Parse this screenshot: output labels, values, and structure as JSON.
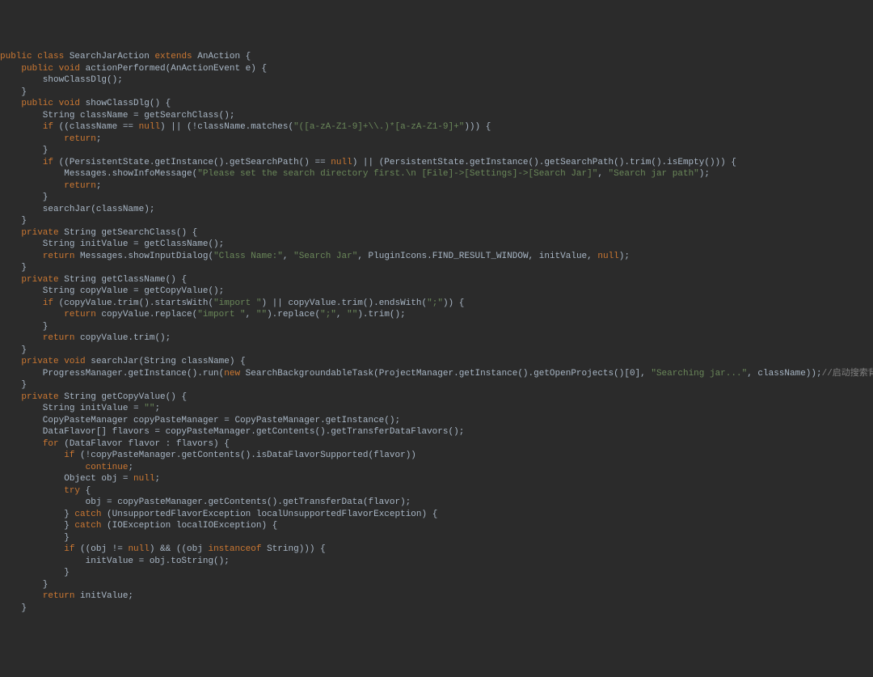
{
  "code": {
    "lines": [
      "public class SearchJarAction extends AnAction {",
      "    public void actionPerformed(AnActionEvent e) {",
      "        showClassDlg();",
      "    }",
      "",
      "    public void showClassDlg() {",
      "        String className = getSearchClass();",
      "        if ((className == null) || (!className.matches(\"([a-zA-Z1-9]+\\\\.)*[a-zA-Z1-9]+\"))) {",
      "            return;",
      "        }",
      "        if ((PersistentState.getInstance().getSearchPath() == null) || (PersistentState.getInstance().getSearchPath().trim().isEmpty())) {",
      "            Messages.showInfoMessage(\"Please set the search directory first.\\n [File]->[Settings]->[Search Jar]\", \"Search jar path\");",
      "            return;",
      "        }",
      "        searchJar(className);",
      "    }",
      "",
      "    private String getSearchClass() {",
      "        String initValue = getClassName();",
      "        return Messages.showInputDialog(\"Class Name:\", \"Search Jar\", PluginIcons.FIND_RESULT_WINDOW, initValue, null);",
      "    }",
      "",
      "    private String getClassName() {",
      "        String copyValue = getCopyValue();",
      "        if (copyValue.trim().startsWith(\"import \") || copyValue.trim().endsWith(\";\")) {",
      "            return copyValue.replace(\"import \", \"\").replace(\";\", \"\").trim();",
      "        }",
      "        return copyValue.trim();",
      "    }",
      "",
      "    private void searchJar(String className) {",
      "        ProgressManager.getInstance().run(new SearchBackgroundableTask(ProjectManager.getInstance().getOpenProjects()[0], \"Searching jar...\", className));//启动搜索背景任务",
      "    }",
      "",
      "    private String getCopyValue() {",
      "        String initValue = \"\";",
      "        CopyPasteManager copyPasteManager = CopyPasteManager.getInstance();",
      "        DataFlavor[] flavors = copyPasteManager.getContents().getTransferDataFlavors();",
      "        for (DataFlavor flavor : flavors) {",
      "            if (!copyPasteManager.getContents().isDataFlavorSupported(flavor))",
      "                continue;",
      "            Object obj = null;",
      "            try {",
      "                obj = copyPasteManager.getContents().getTransferData(flavor);",
      "            } catch (UnsupportedFlavorException localUnsupportedFlavorException) {",
      "            } catch (IOException localIOException) {",
      "            }",
      "            if ((obj != null) && ((obj instanceof String))) {",
      "                initValue = obj.toString();",
      "            }",
      "        }",
      "        return initValue;",
      "    }"
    ]
  }
}
